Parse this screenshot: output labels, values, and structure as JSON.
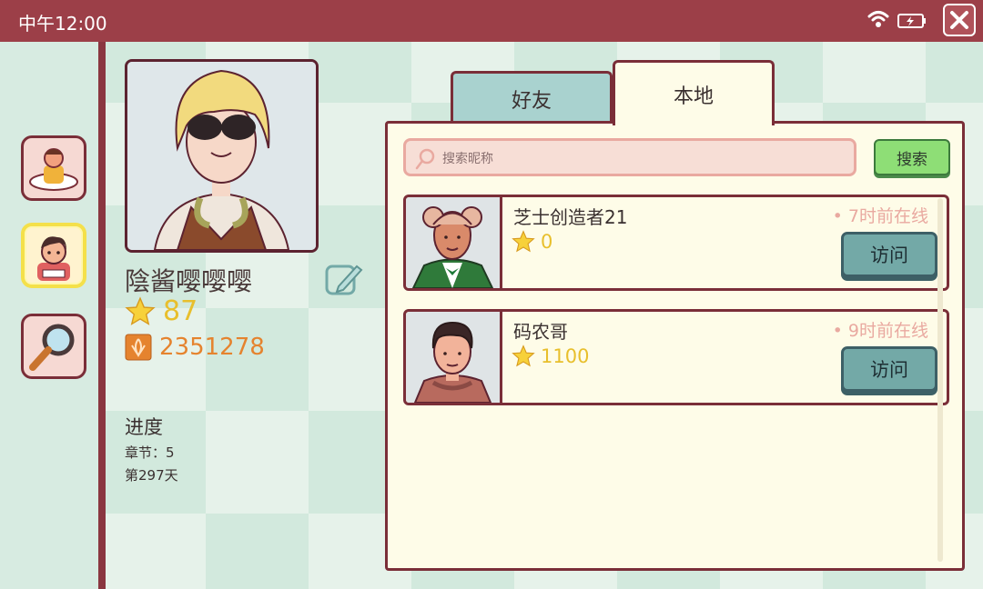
{
  "status_bar": {
    "time": "中午12:00"
  },
  "icons": {
    "wifi": "wifi-icon",
    "battery": "battery-charging-icon",
    "close": "close-icon",
    "nav": [
      "profile-nav-icon",
      "friends-nav-icon",
      "search-nav-icon"
    ],
    "edit": "edit-pencil-icon",
    "star": "star-icon",
    "coin": "coin-icon",
    "search": "search-icon"
  },
  "player": {
    "name": "陰酱嘤嘤嘤",
    "stars": "87",
    "coins": "2351278"
  },
  "progress": {
    "title": "进度",
    "chapter": "章节：5",
    "day": "第297天"
  },
  "tabs": {
    "friends": "好友",
    "local": "本地"
  },
  "search": {
    "placeholder": "搜索昵称",
    "button": "搜索"
  },
  "users": [
    {
      "name": "芝士创造者21",
      "stars": "0",
      "online": "• 7时前在线",
      "visit": "访问"
    },
    {
      "name": "码农哥",
      "stars": "1100",
      "online": "• 9时前在线",
      "visit": "访问"
    }
  ],
  "colors": {
    "top_bar": "#9c3f48",
    "border": "#7a2e38",
    "panel_bg": "#fefce8",
    "search_button": "#8ede76",
    "visit_button": "#73a9a7",
    "star": "#e8bf2c",
    "coin_text": "#e5832e"
  }
}
